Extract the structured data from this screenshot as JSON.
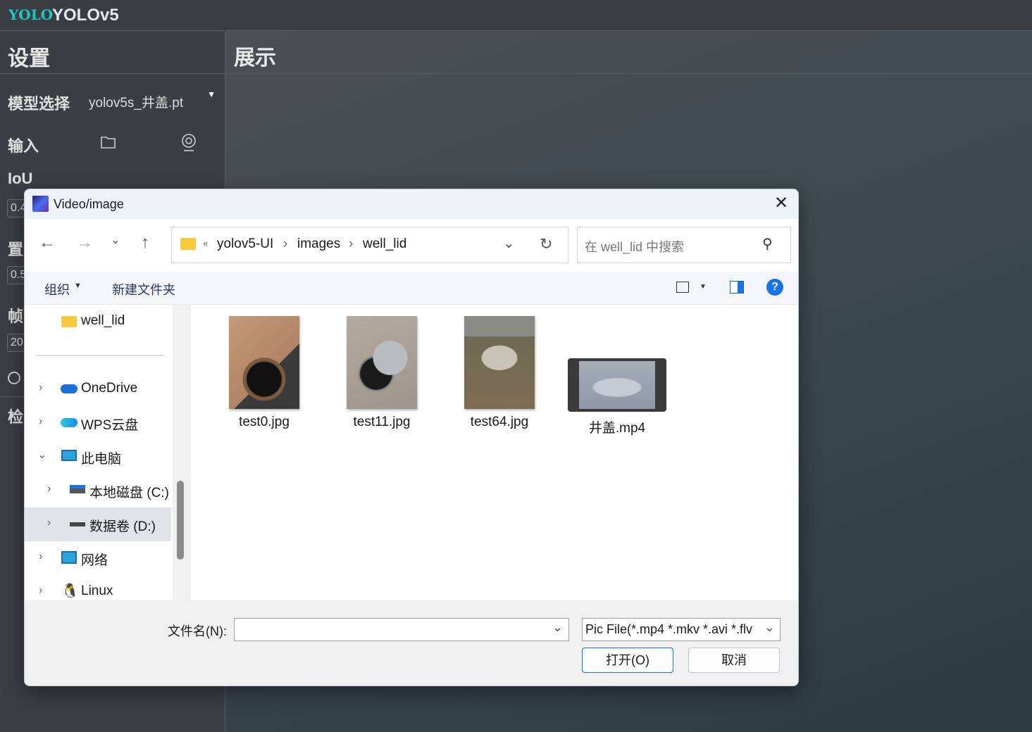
{
  "app": {
    "logo": "YOLO",
    "title": "YOLOv5"
  },
  "settings": {
    "header": "设置",
    "model_label": "模型选择",
    "model_value": "yolov5s_井盖.pt",
    "input_label": "输入",
    "iou_label": "IoU",
    "iou_value": "0.4",
    "conf_label": "置",
    "conf_value": "0.5",
    "frame_label": "帧",
    "frame_value": "20",
    "detect_label": "检"
  },
  "display": {
    "header": "展示"
  },
  "dialog": {
    "title": "Video/image",
    "breadcrumb": [
      "yolov5-UI",
      "images",
      "well_lid"
    ],
    "breadcrumb_prefix": "«",
    "search_placeholder": "在 well_lid 中搜索",
    "toolbar": {
      "organize": "组织",
      "new_folder": "新建文件夹"
    },
    "nav": [
      {
        "label": "well_lid",
        "icon": "folder-icon"
      },
      {
        "label": "OneDrive",
        "icon": "cloud-icon"
      },
      {
        "label": "WPS云盘",
        "icon": "cloud-icon"
      },
      {
        "label": "此电脑",
        "icon": "computer-icon"
      },
      {
        "label": "本地磁盘 (C:)",
        "icon": "drive-icon"
      },
      {
        "label": "数据卷 (D:)",
        "icon": "drive-icon",
        "selected": true
      },
      {
        "label": "网络",
        "icon": "network-icon"
      },
      {
        "label": "Linux",
        "icon": "linux-icon"
      }
    ],
    "files": [
      {
        "name": "test0.jpg"
      },
      {
        "name": "test11.jpg"
      },
      {
        "name": "test64.jpg"
      },
      {
        "name": "井盖.mp4"
      }
    ],
    "filename_label": "文件名(N):",
    "filename_value": "",
    "filter": "Pic File(*.mp4 *.mkv *.avi *.flv",
    "open_label": "打开(O)",
    "cancel_label": "取消"
  }
}
